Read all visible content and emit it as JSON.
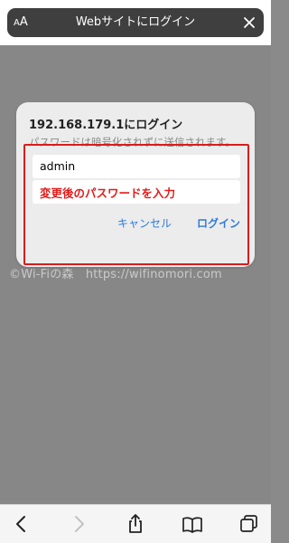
{
  "header": {
    "reader_label_small": "A",
    "reader_label_large": "A",
    "title": "Webサイトにログイン"
  },
  "dialog": {
    "title": "192.168.179.1にログイン",
    "message": "パスワードは暗号化されずに送信されます。",
    "username_value": "admin",
    "password_hint": "変更後のパスワードを入力",
    "cancel_label": "キャンセル",
    "login_label": "ログイン"
  },
  "watermark": "©Wi-Fiの森　https://wifinomori.com",
  "toolbar": {
    "icons": [
      "back-icon",
      "forward-icon",
      "share-icon",
      "bookmarks-icon",
      "tabs-icon"
    ]
  },
  "colors": {
    "accent": "#2f7ad8",
    "highlight": "#d81d1d",
    "hint_text": "#e11c1c"
  }
}
